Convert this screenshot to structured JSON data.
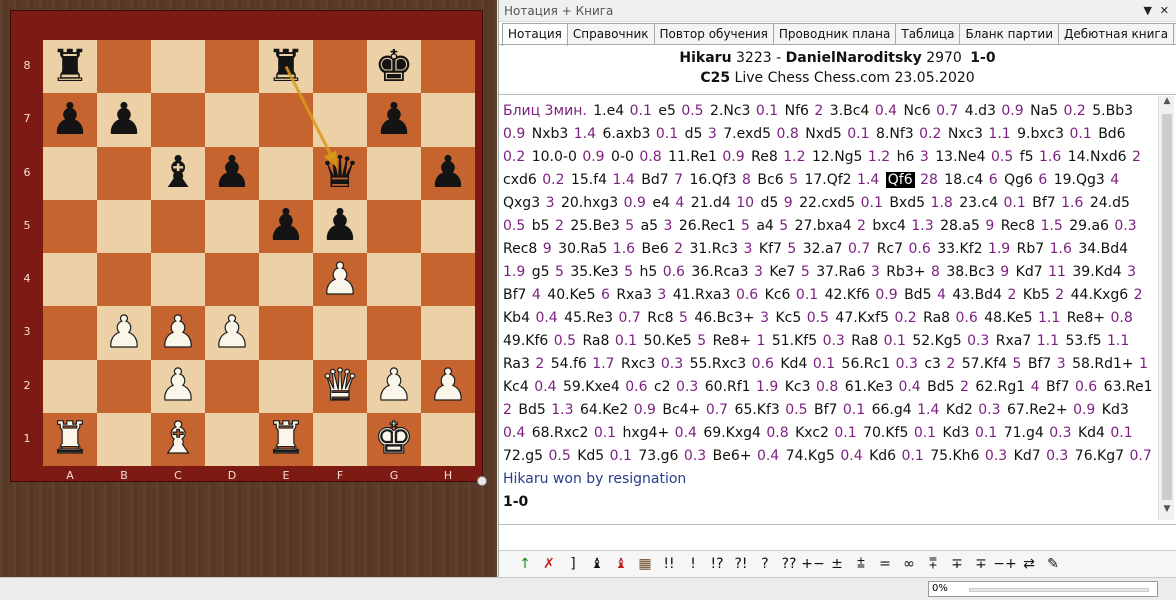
{
  "panel": {
    "title": "Нотация + Книга",
    "pin": "▼",
    "close": "✕"
  },
  "tabs": [
    {
      "label": "Нотация",
      "active": true
    },
    {
      "label": "Справочник"
    },
    {
      "label": "Повтор обучения"
    },
    {
      "label": "Проводник плана"
    },
    {
      "label": "Таблица"
    },
    {
      "label": "Бланк партии"
    },
    {
      "label": "Дебютная книга"
    },
    {
      "label": "Книга"
    }
  ],
  "game": {
    "white": "Hikaru",
    "white_elo": "3223",
    "black": "DanielNaroditsky",
    "black_elo": "2970",
    "result": "1-0",
    "eco": "C25",
    "event": "Live Chess Chess.com 23.05.2020",
    "time_control": "Блиц 3мин."
  },
  "moves": [
    [
      "1.e4",
      "0.1"
    ],
    [
      "e5",
      "0.5"
    ],
    [
      "2.Nc3",
      "0.1"
    ],
    [
      "Nf6",
      "2"
    ],
    [
      "3.Bc4",
      "0.4"
    ],
    [
      "Nc6",
      "0.7"
    ],
    [
      "4.d3",
      "0.9"
    ],
    [
      "Na5",
      "0.2"
    ],
    [
      "5.Bb3",
      "0.9"
    ],
    [
      "Nxb3",
      "1.4"
    ],
    [
      "6.axb3",
      "0.1"
    ],
    [
      "d5",
      "3"
    ],
    [
      "7.exd5",
      "0.8"
    ],
    [
      "Nxd5",
      "0.1"
    ],
    [
      "8.Nf3",
      "0.2"
    ],
    [
      "Nxc3",
      "1.1"
    ],
    [
      "9.bxc3",
      "0.1"
    ],
    [
      "Bd6",
      "0.2"
    ],
    [
      "10.0-0",
      "0.9"
    ],
    [
      "0-0",
      "0.8"
    ],
    [
      "11.Re1",
      "0.9"
    ],
    [
      "Re8",
      "1.2"
    ],
    [
      "12.Ng5",
      "1.2"
    ],
    [
      "h6",
      "3"
    ],
    [
      "13.Ne4",
      "0.5"
    ],
    [
      "f5",
      "1.6"
    ],
    [
      "14.Nxd6",
      "2"
    ],
    [
      "cxd6",
      "0.2"
    ],
    [
      "15.f4",
      "1.4"
    ],
    [
      "Bd7",
      "7"
    ],
    [
      "16.Qf3",
      "8"
    ],
    [
      "Bc6",
      "5"
    ],
    [
      "17.Qf2",
      "1.4"
    ],
    [
      "Qf6",
      "28"
    ],
    [
      "18.c4",
      "6"
    ],
    [
      "Qg6",
      "6"
    ],
    [
      "19.Qg3",
      "4"
    ],
    [
      "Qxg3",
      "3"
    ],
    [
      "20.hxg3",
      "0.9"
    ],
    [
      "e4",
      "4"
    ],
    [
      "21.d4",
      "10"
    ],
    [
      "d5",
      "9"
    ],
    [
      "22.cxd5",
      "0.1"
    ],
    [
      "Bxd5",
      "1.8"
    ],
    [
      "23.c4",
      "0.1"
    ],
    [
      "Bf7",
      "1.6"
    ],
    [
      "24.d5",
      "0.5"
    ],
    [
      "b5",
      "2"
    ],
    [
      "25.Be3",
      "5"
    ],
    [
      "a5",
      "3"
    ],
    [
      "26.Rec1",
      "5"
    ],
    [
      "a4",
      "5"
    ],
    [
      "27.bxa4",
      "2"
    ],
    [
      "bxc4",
      "1.3"
    ],
    [
      "28.a5",
      "9"
    ],
    [
      "Rec8",
      "1.5"
    ],
    [
      "29.a6",
      "0.3"
    ],
    [
      "Rec8",
      "9"
    ],
    [
      "30.Ra5",
      "1.6"
    ],
    [
      "Be6",
      "2"
    ],
    [
      "31.Rc3",
      "3"
    ],
    [
      "Kf7",
      "5"
    ],
    [
      "32.a7",
      "0.7"
    ],
    [
      "Rc7",
      "0.6"
    ],
    [
      "33.Kf2",
      "1.9"
    ],
    [
      "Rb7",
      "1.6"
    ],
    [
      "34.Bd4",
      "1.9"
    ],
    [
      "g5",
      "5"
    ],
    [
      "35.Ke3",
      "5"
    ],
    [
      "h5",
      "0.6"
    ],
    [
      "36.Rca3",
      "3"
    ],
    [
      "Ke7",
      "5"
    ],
    [
      "37.Ra6",
      "3"
    ],
    [
      "Rb3+",
      "8"
    ],
    [
      "38.Bc3",
      "9"
    ],
    [
      "Kd7",
      "11"
    ],
    [
      "39.Kd4",
      "3"
    ],
    [
      "Bf7",
      "4"
    ],
    [
      "40.Ke5",
      "6"
    ],
    [
      "Rxa3",
      "3"
    ],
    [
      "41.Rxa3",
      "0.6"
    ],
    [
      "Kc6",
      "0.1"
    ],
    [
      "42.Kf6",
      "0.9"
    ],
    [
      "Bd5",
      "4"
    ],
    [
      "43.Bd4",
      "2"
    ],
    [
      "Kb5",
      "2"
    ],
    [
      "44.Kxg6",
      "2"
    ],
    [
      "Kb4",
      "0.4"
    ],
    [
      "45.Re3",
      "0.7"
    ],
    [
      "Rc8",
      "5"
    ],
    [
      "46.Bc3+",
      "3"
    ],
    [
      "Kc5",
      "0.5"
    ],
    [
      "47.Kxf5",
      "0.2"
    ],
    [
      "Ra8",
      "0.6"
    ],
    [
      "48.Ke5",
      "1.1"
    ],
    [
      "Re8+",
      "0.8"
    ],
    [
      "49.Kf6",
      "0.5"
    ],
    [
      "Ra8",
      "0.1"
    ],
    [
      "50.Ke5",
      "5"
    ],
    [
      "Re8+",
      "1"
    ],
    [
      "51.Kf5",
      "0.3"
    ],
    [
      "Ra8",
      "0.1"
    ],
    [
      "52.Kg5",
      "0.3"
    ],
    [
      "Rxa7",
      "1.1"
    ],
    [
      "53.f5",
      "1.1"
    ],
    [
      "Ra3",
      "2"
    ],
    [
      "54.f6",
      "1.7"
    ],
    [
      "Rxc3",
      "0.3"
    ],
    [
      "55.Rxc3",
      "0.6"
    ],
    [
      "Kd4",
      "0.1"
    ],
    [
      "56.Rc1",
      "0.3"
    ],
    [
      "c3",
      "2"
    ],
    [
      "57.Kf4",
      "5"
    ],
    [
      "Bf7",
      "3"
    ],
    [
      "58.Rd1+",
      "1"
    ],
    [
      "Kc4",
      "0.4"
    ],
    [
      "59.Kxe4",
      "0.6"
    ],
    [
      "c2",
      "0.3"
    ],
    [
      "60.Rf1",
      "1.9"
    ],
    [
      "Kc3",
      "0.8"
    ],
    [
      "61.Ke3",
      "0.4"
    ],
    [
      "Bd5",
      "2"
    ],
    [
      "62.Rg1",
      "4"
    ],
    [
      "Bf7",
      "0.6"
    ],
    [
      "63.Re1",
      "2"
    ],
    [
      "Bd5",
      "1.3"
    ],
    [
      "64.Ke2",
      "0.9"
    ],
    [
      "Bc4+",
      "0.7"
    ],
    [
      "65.Kf3",
      "0.5"
    ],
    [
      "Bf7",
      "0.1"
    ],
    [
      "66.g4",
      "1.4"
    ],
    [
      "Kd2",
      "0.3"
    ],
    [
      "67.Re2+",
      "0.9"
    ],
    [
      "Kd3",
      "0.4"
    ],
    [
      "68.Rxc2",
      "0.1"
    ],
    [
      "hxg4+",
      "0.4"
    ],
    [
      "69.Kxg4",
      "0.8"
    ],
    [
      "Kxc2",
      "0.1"
    ],
    [
      "70.Kf5",
      "0.1"
    ],
    [
      "Kd3",
      "0.1"
    ],
    [
      "71.g4",
      "0.3"
    ],
    [
      "Kd4",
      "0.1"
    ],
    [
      "72.g5",
      "0.5"
    ],
    [
      "Kd5",
      "0.1"
    ],
    [
      "73.g6",
      "0.3"
    ],
    [
      "Be6+",
      "0.4"
    ],
    [
      "74.Kg5",
      "0.4"
    ],
    [
      "Kd6",
      "0.1"
    ],
    [
      "75.Kh6",
      "0.3"
    ],
    [
      "Kd7",
      "0.3"
    ],
    [
      "76.Kg7",
      "0.7"
    ]
  ],
  "highlighted_move": "Qf6",
  "result_text": "Hikaru won by resignation",
  "final_score": "1-0",
  "board": {
    "ranks": [
      "8",
      "7",
      "6",
      "5",
      "4",
      "3",
      "2",
      "1"
    ],
    "files": [
      "A",
      "B",
      "C",
      "D",
      "E",
      "F",
      "G",
      "H"
    ],
    "position": [
      [
        "r",
        "",
        "",
        "",
        "r",
        "",
        "k",
        ""
      ],
      [
        "p",
        "p",
        "",
        "",
        "",
        "",
        "p",
        ""
      ],
      [
        "",
        "",
        "b",
        "p",
        "",
        "q",
        "",
        "p"
      ],
      [
        "",
        "",
        "",
        "",
        "p",
        "p",
        "",
        ""
      ],
      [
        "",
        "",
        "",
        "",
        "",
        "P",
        "",
        ""
      ],
      [
        "",
        "P",
        "P",
        "P",
        "",
        "",
        "",
        ""
      ],
      [
        "",
        "",
        "P",
        "",
        "",
        "Q",
        "P",
        "P"
      ],
      [
        "R",
        "",
        "B",
        "",
        "R",
        "",
        "K",
        ""
      ]
    ],
    "arrow": {
      "from": "e8",
      "to": "f6",
      "color": "#d99a1a"
    }
  },
  "toolbar": [
    "↑",
    "✗",
    "]",
    "♝",
    "♝",
    "▦",
    "!!",
    "!",
    "!?",
    "?!",
    "?",
    "??",
    "+−",
    "±",
    "⩲",
    "=",
    "∞",
    "⩱",
    "∓",
    "∓",
    "−+",
    "⇄",
    "✎"
  ],
  "status": {
    "progress_text": "0%",
    "progress": 0
  }
}
